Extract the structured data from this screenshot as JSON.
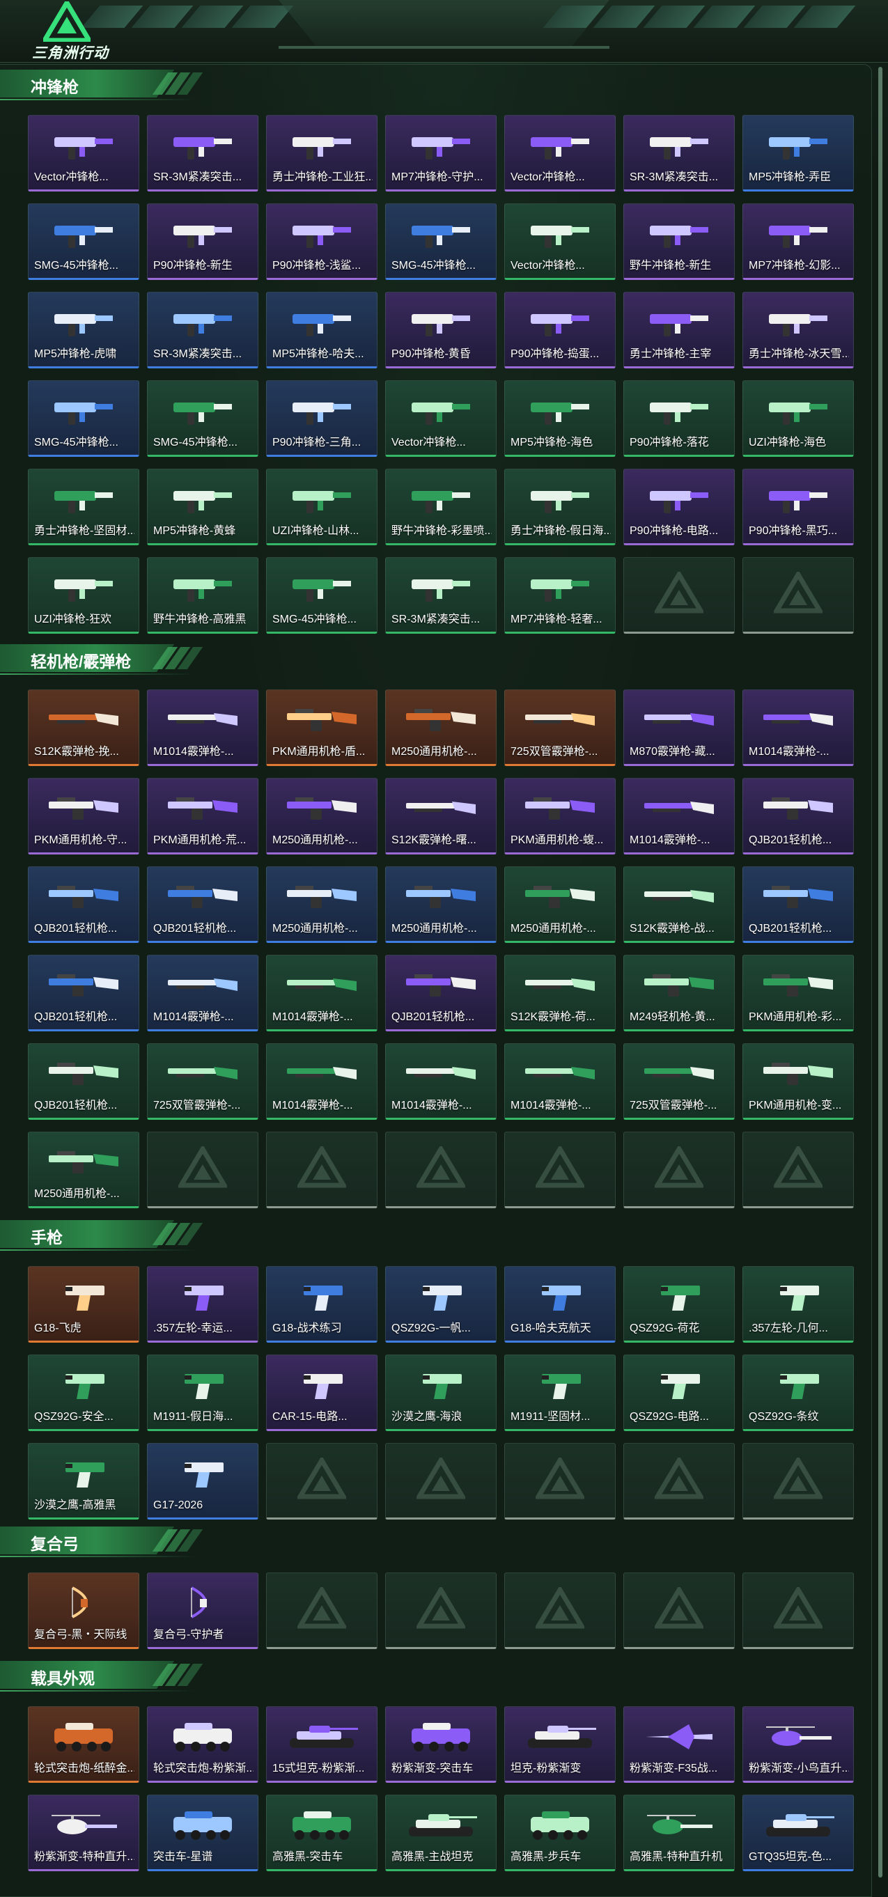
{
  "app": {
    "logo_text": "三角洲行动"
  },
  "colors": {
    "rarity_purple": "#9a6bd6",
    "rarity_blue": "#3f7ee0",
    "rarity_green": "#35b866",
    "rarity_orange": "#e07a33",
    "empty": "#8d9a92",
    "section_accent": "#2c8a4a"
  },
  "sections": [
    {
      "title": "冲锋枪",
      "items": [
        {
          "name": "Vector冲锋枪...",
          "rarity": "purple",
          "icon": "smg-icon"
        },
        {
          "name": "SR-3M紧凑突击...",
          "rarity": "purple",
          "icon": "smg-icon"
        },
        {
          "name": "勇士冲锋枪-工业狂...",
          "rarity": "purple",
          "icon": "smg-icon"
        },
        {
          "name": "MP7冲锋枪-守护...",
          "rarity": "purple",
          "icon": "smg-icon"
        },
        {
          "name": "Vector冲锋枪...",
          "rarity": "purple",
          "icon": "smg-icon"
        },
        {
          "name": "SR-3M紧凑突击...",
          "rarity": "purple",
          "icon": "smg-icon"
        },
        {
          "name": "MP5冲锋枪-弄臣",
          "rarity": "blue",
          "icon": "smg-icon"
        },
        {
          "name": "SMG-45冲锋枪...",
          "rarity": "blue",
          "icon": "smg-icon"
        },
        {
          "name": "P90冲锋枪-新生",
          "rarity": "purple",
          "icon": "smg-icon"
        },
        {
          "name": "P90冲锋枪-浅鲨...",
          "rarity": "purple",
          "icon": "smg-icon"
        },
        {
          "name": "SMG-45冲锋枪...",
          "rarity": "blue",
          "icon": "smg-icon"
        },
        {
          "name": "Vector冲锋枪...",
          "rarity": "green",
          "icon": "smg-icon"
        },
        {
          "name": "野牛冲锋枪-新生",
          "rarity": "purple",
          "icon": "smg-icon"
        },
        {
          "name": "MP7冲锋枪-幻影...",
          "rarity": "purple",
          "icon": "smg-icon"
        },
        {
          "name": "MP5冲锋枪-虎啸",
          "rarity": "blue",
          "icon": "smg-icon"
        },
        {
          "name": "SR-3M紧凑突击...",
          "rarity": "blue",
          "icon": "smg-icon"
        },
        {
          "name": "MP5冲锋枪-哈夫...",
          "rarity": "blue",
          "icon": "smg-icon"
        },
        {
          "name": "P90冲锋枪-黄昏",
          "rarity": "purple",
          "icon": "smg-icon"
        },
        {
          "name": "P90冲锋枪-捣蛋...",
          "rarity": "purple",
          "icon": "smg-icon"
        },
        {
          "name": "勇士冲锋枪-主宰",
          "rarity": "purple",
          "icon": "smg-icon"
        },
        {
          "name": "勇士冲锋枪-冰天雪...",
          "rarity": "purple",
          "icon": "smg-icon"
        },
        {
          "name": "SMG-45冲锋枪...",
          "rarity": "blue",
          "icon": "smg-icon"
        },
        {
          "name": "SMG-45冲锋枪...",
          "rarity": "green",
          "icon": "smg-icon"
        },
        {
          "name": "P90冲锋枪-三角...",
          "rarity": "blue",
          "icon": "smg-icon"
        },
        {
          "name": "Vector冲锋枪...",
          "rarity": "green",
          "icon": "smg-icon"
        },
        {
          "name": "MP5冲锋枪-海色",
          "rarity": "green",
          "icon": "smg-icon"
        },
        {
          "name": "P90冲锋枪-落花",
          "rarity": "green",
          "icon": "smg-icon"
        },
        {
          "name": "UZI冲锋枪-海色",
          "rarity": "green",
          "icon": "smg-icon"
        },
        {
          "name": "勇士冲锋枪-坚固材...",
          "rarity": "green",
          "icon": "smg-icon"
        },
        {
          "name": "MP5冲锋枪-黄蜂",
          "rarity": "green",
          "icon": "smg-icon"
        },
        {
          "name": "UZI冲锋枪-山林...",
          "rarity": "green",
          "icon": "smg-icon"
        },
        {
          "name": "野牛冲锋枪-彩墨喷...",
          "rarity": "green",
          "icon": "smg-icon"
        },
        {
          "name": "勇士冲锋枪-假日海...",
          "rarity": "green",
          "icon": "smg-icon"
        },
        {
          "name": "P90冲锋枪-电路...",
          "rarity": "purple",
          "icon": "smg-icon"
        },
        {
          "name": "P90冲锋枪-黑巧...",
          "rarity": "purple",
          "icon": "smg-icon"
        },
        {
          "name": "UZI冲锋枪-狂欢",
          "rarity": "green",
          "icon": "smg-icon"
        },
        {
          "name": "野牛冲锋枪-高雅黑",
          "rarity": "green",
          "icon": "smg-icon"
        },
        {
          "name": "SMG-45冲锋枪...",
          "rarity": "green",
          "icon": "smg-icon"
        },
        {
          "name": "SR-3M紧凑突击...",
          "rarity": "green",
          "icon": "smg-icon"
        },
        {
          "name": "MP7冲锋枪-轻奢...",
          "rarity": "green",
          "icon": "smg-icon"
        },
        {
          "name": "",
          "rarity": "empty",
          "icon": "triangle-logo-icon"
        },
        {
          "name": "",
          "rarity": "empty",
          "icon": "triangle-logo-icon"
        }
      ]
    },
    {
      "title": "轻机枪/霰弹枪",
      "items": [
        {
          "name": "S12K霰弹枪-挽...",
          "rarity": "orange",
          "icon": "shotgun-icon"
        },
        {
          "name": "M1014霰弹枪-...",
          "rarity": "purple",
          "icon": "shotgun-icon"
        },
        {
          "name": "PKM通用机枪-盾...",
          "rarity": "orange",
          "icon": "lmg-icon"
        },
        {
          "name": "M250通用机枪-...",
          "rarity": "orange",
          "icon": "lmg-icon"
        },
        {
          "name": "725双管霰弹枪-...",
          "rarity": "orange",
          "icon": "shotgun-icon"
        },
        {
          "name": "M870霰弹枪-藏...",
          "rarity": "purple",
          "icon": "shotgun-icon"
        },
        {
          "name": "M1014霰弹枪-...",
          "rarity": "purple",
          "icon": "shotgun-icon"
        },
        {
          "name": "PKM通用机枪-守...",
          "rarity": "purple",
          "icon": "lmg-icon"
        },
        {
          "name": "PKM通用机枪-荒...",
          "rarity": "purple",
          "icon": "lmg-icon"
        },
        {
          "name": "M250通用机枪-...",
          "rarity": "purple",
          "icon": "lmg-icon"
        },
        {
          "name": "S12K霰弹枪-曙...",
          "rarity": "purple",
          "icon": "shotgun-icon"
        },
        {
          "name": "PKM通用机枪-蝮...",
          "rarity": "purple",
          "icon": "lmg-icon"
        },
        {
          "name": "M1014霰弹枪-...",
          "rarity": "purple",
          "icon": "shotgun-icon"
        },
        {
          "name": "QJB201轻机枪...",
          "rarity": "purple",
          "icon": "lmg-icon"
        },
        {
          "name": "QJB201轻机枪...",
          "rarity": "blue",
          "icon": "lmg-icon"
        },
        {
          "name": "QJB201轻机枪...",
          "rarity": "blue",
          "icon": "lmg-icon"
        },
        {
          "name": "M250通用机枪-...",
          "rarity": "blue",
          "icon": "lmg-icon"
        },
        {
          "name": "M250通用机枪-...",
          "rarity": "blue",
          "icon": "lmg-icon"
        },
        {
          "name": "M250通用机枪-...",
          "rarity": "green",
          "icon": "lmg-icon"
        },
        {
          "name": "S12K霰弹枪-战...",
          "rarity": "green",
          "icon": "shotgun-icon"
        },
        {
          "name": "QJB201轻机枪...",
          "rarity": "blue",
          "icon": "lmg-icon"
        },
        {
          "name": "QJB201轻机枪...",
          "rarity": "blue",
          "icon": "lmg-icon"
        },
        {
          "name": "M1014霰弹枪-...",
          "rarity": "blue",
          "icon": "shotgun-icon"
        },
        {
          "name": "M1014霰弹枪-...",
          "rarity": "green",
          "icon": "shotgun-icon"
        },
        {
          "name": "QJB201轻机枪...",
          "rarity": "purple",
          "icon": "lmg-icon"
        },
        {
          "name": "S12K霰弹枪-荷...",
          "rarity": "green",
          "icon": "shotgun-icon"
        },
        {
          "name": "M249轻机枪-黄...",
          "rarity": "green",
          "icon": "lmg-icon"
        },
        {
          "name": "PKM通用机枪-彩...",
          "rarity": "green",
          "icon": "lmg-icon"
        },
        {
          "name": "QJB201轻机枪...",
          "rarity": "green",
          "icon": "lmg-icon"
        },
        {
          "name": "725双管霰弹枪-...",
          "rarity": "green",
          "icon": "shotgun-icon"
        },
        {
          "name": "M1014霰弹枪-...",
          "rarity": "green",
          "icon": "shotgun-icon"
        },
        {
          "name": "M1014霰弹枪-...",
          "rarity": "green",
          "icon": "shotgun-icon"
        },
        {
          "name": "M1014霰弹枪-...",
          "rarity": "green",
          "icon": "shotgun-icon"
        },
        {
          "name": "725双管霰弹枪-...",
          "rarity": "green",
          "icon": "shotgun-icon"
        },
        {
          "name": "PKM通用机枪-变...",
          "rarity": "green",
          "icon": "lmg-icon"
        },
        {
          "name": "M250通用机枪-...",
          "rarity": "green",
          "icon": "lmg-icon"
        },
        {
          "name": "",
          "rarity": "empty",
          "icon": "triangle-logo-icon"
        },
        {
          "name": "",
          "rarity": "empty",
          "icon": "triangle-logo-icon"
        },
        {
          "name": "",
          "rarity": "empty",
          "icon": "triangle-logo-icon"
        },
        {
          "name": "",
          "rarity": "empty",
          "icon": "triangle-logo-icon"
        },
        {
          "name": "",
          "rarity": "empty",
          "icon": "triangle-logo-icon"
        },
        {
          "name": "",
          "rarity": "empty",
          "icon": "triangle-logo-icon"
        }
      ]
    },
    {
      "title": "手枪",
      "items": [
        {
          "name": "G18-飞虎",
          "rarity": "orange",
          "icon": "pistol-icon"
        },
        {
          "name": ".357左轮-幸运...",
          "rarity": "purple",
          "icon": "pistol-icon"
        },
        {
          "name": "G18-战术练习",
          "rarity": "blue",
          "icon": "pistol-icon"
        },
        {
          "name": "QSZ92G-一帆...",
          "rarity": "blue",
          "icon": "pistol-icon"
        },
        {
          "name": "G18-哈夫克航天",
          "rarity": "blue",
          "icon": "pistol-icon"
        },
        {
          "name": "QSZ92G-荷花",
          "rarity": "green",
          "icon": "pistol-icon"
        },
        {
          "name": ".357左轮-几何...",
          "rarity": "green",
          "icon": "pistol-icon"
        },
        {
          "name": "QSZ92G-安全...",
          "rarity": "green",
          "icon": "pistol-icon"
        },
        {
          "name": "M1911-假日海...",
          "rarity": "green",
          "icon": "pistol-icon"
        },
        {
          "name": "CAR-15-电路...",
          "rarity": "purple",
          "icon": "pistol-icon"
        },
        {
          "name": "沙漠之鹰-海浪",
          "rarity": "green",
          "icon": "pistol-icon"
        },
        {
          "name": "M1911-坚固材...",
          "rarity": "green",
          "icon": "pistol-icon"
        },
        {
          "name": "QSZ92G-电路...",
          "rarity": "green",
          "icon": "pistol-icon"
        },
        {
          "name": "QSZ92G-条纹",
          "rarity": "green",
          "icon": "pistol-icon"
        },
        {
          "name": "沙漠之鹰-高雅黑",
          "rarity": "green",
          "icon": "pistol-icon"
        },
        {
          "name": "G17-2026",
          "rarity": "blue",
          "icon": "pistol-icon"
        },
        {
          "name": "",
          "rarity": "empty",
          "icon": "triangle-logo-icon"
        },
        {
          "name": "",
          "rarity": "empty",
          "icon": "triangle-logo-icon"
        },
        {
          "name": "",
          "rarity": "empty",
          "icon": "triangle-logo-icon"
        },
        {
          "name": "",
          "rarity": "empty",
          "icon": "triangle-logo-icon"
        },
        {
          "name": "",
          "rarity": "empty",
          "icon": "triangle-logo-icon"
        }
      ]
    },
    {
      "title": "复合弓",
      "items": [
        {
          "name": "复合弓-黑・天际线",
          "rarity": "orange",
          "icon": "bow-icon"
        },
        {
          "name": "复合弓-守护者",
          "rarity": "purple",
          "icon": "bow-icon"
        },
        {
          "name": "",
          "rarity": "empty",
          "icon": "triangle-logo-icon"
        },
        {
          "name": "",
          "rarity": "empty",
          "icon": "triangle-logo-icon"
        },
        {
          "name": "",
          "rarity": "empty",
          "icon": "triangle-logo-icon"
        },
        {
          "name": "",
          "rarity": "empty",
          "icon": "triangle-logo-icon"
        },
        {
          "name": "",
          "rarity": "empty",
          "icon": "triangle-logo-icon"
        }
      ]
    },
    {
      "title": "载具外观",
      "items": [
        {
          "name": "轮式突击炮-纸醉金...",
          "rarity": "orange",
          "icon": "vehicle-icon"
        },
        {
          "name": "轮式突击炮-粉紫渐...",
          "rarity": "purple",
          "icon": "vehicle-icon"
        },
        {
          "name": "15式坦克-粉紫渐...",
          "rarity": "purple",
          "icon": "tank-icon"
        },
        {
          "name": "粉紫渐变-突击车",
          "rarity": "purple",
          "icon": "vehicle-icon"
        },
        {
          "name": "坦克-粉紫渐变",
          "rarity": "purple",
          "icon": "tank-icon"
        },
        {
          "name": "粉紫渐变-F35战...",
          "rarity": "purple",
          "icon": "jet-icon"
        },
        {
          "name": "粉紫渐变-小鸟直升...",
          "rarity": "purple",
          "icon": "helicopter-icon"
        },
        {
          "name": "粉紫渐变-特种直升...",
          "rarity": "purple",
          "icon": "helicopter-icon"
        },
        {
          "name": "突击车-星谱",
          "rarity": "blue",
          "icon": "vehicle-icon"
        },
        {
          "name": "高雅黑-突击车",
          "rarity": "green",
          "icon": "vehicle-icon"
        },
        {
          "name": "高雅黑-主战坦克",
          "rarity": "green",
          "icon": "tank-icon"
        },
        {
          "name": "高雅黑-步兵车",
          "rarity": "green",
          "icon": "vehicle-icon"
        },
        {
          "name": "高雅黑-特种直升机",
          "rarity": "green",
          "icon": "helicopter-icon"
        },
        {
          "name": "GTQ35坦克-色...",
          "rarity": "blue",
          "icon": "tank-icon"
        }
      ]
    }
  ]
}
